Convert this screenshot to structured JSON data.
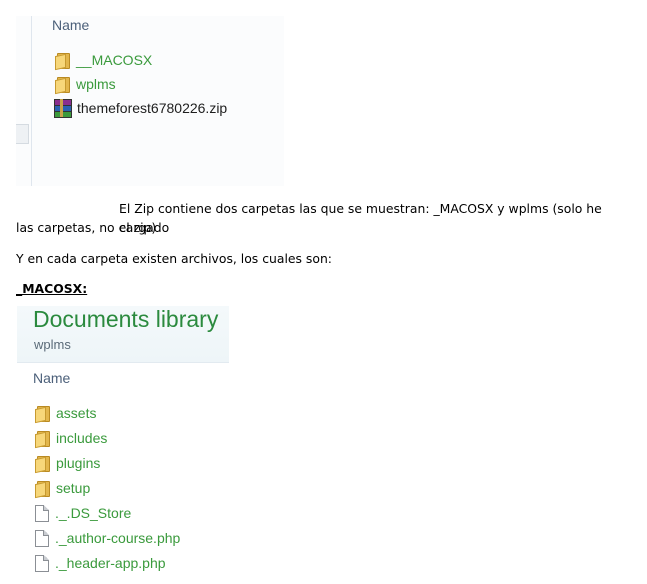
{
  "explorer1": {
    "column_header": "Name",
    "items": [
      {
        "label": "__MACOSX",
        "icon": "folder-icon"
      },
      {
        "label": "wplms",
        "icon": "folder-icon"
      },
      {
        "label": "themeforest6780226.zip",
        "icon": "winrar-archive-icon"
      }
    ]
  },
  "text": {
    "line1": "El Zip contiene dos carpetas las que se muestran: _MACOSX y wplms (solo he cargado",
    "line2": "las carpetas, no el zip)",
    "line3": "Y en cada carpeta existen archivos, los cuales son:",
    "heading": "_MACOSX:"
  },
  "explorer2": {
    "library_title": "Documents library",
    "library_subtitle": "wplms",
    "column_header": "Name",
    "items": [
      {
        "label": "assets",
        "icon": "folder-icon"
      },
      {
        "label": "includes",
        "icon": "folder-icon"
      },
      {
        "label": "plugins",
        "icon": "folder-icon"
      },
      {
        "label": "setup",
        "icon": "folder-icon"
      },
      {
        "label": "._.DS_Store",
        "icon": "file-icon"
      },
      {
        "label": "._author-course.php",
        "icon": "file-icon"
      },
      {
        "label": "._header-app.php",
        "icon": "file-icon"
      }
    ]
  },
  "colors": {
    "item_green": "#3a9a3c",
    "library_title": "#2b8a3e"
  }
}
